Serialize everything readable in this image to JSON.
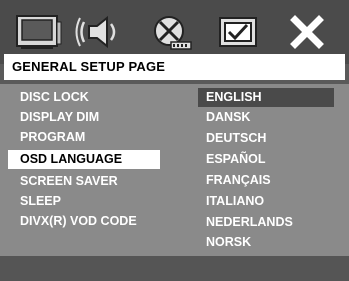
{
  "header": {
    "title": "GENERAL SETUP PAGE"
  },
  "toolbar": {
    "icons": [
      "tv-icon",
      "speaker-icon",
      "video-reel-icon",
      "checkbox-icon",
      "close-icon"
    ]
  },
  "menu": {
    "items": [
      {
        "label": "DISC LOCK"
      },
      {
        "label": "DISPLAY DIM"
      },
      {
        "label": "PROGRAM"
      },
      {
        "label": "OSD LANGUAGE"
      },
      {
        "label": "SCREEN SAVER"
      },
      {
        "label": "SLEEP"
      },
      {
        "label": "DIVX(R) VOD CODE"
      }
    ],
    "active_index": 3
  },
  "options": {
    "items": [
      {
        "label": "ENGLISH"
      },
      {
        "label": "DANSK"
      },
      {
        "label": "DEUTSCH"
      },
      {
        "label": "ESPAÑOL"
      },
      {
        "label": "FRANÇAIS"
      },
      {
        "label": "ITALIANO"
      },
      {
        "label": "NEDERLANDS"
      },
      {
        "label": "NORSK"
      }
    ],
    "selected_index": 0
  }
}
